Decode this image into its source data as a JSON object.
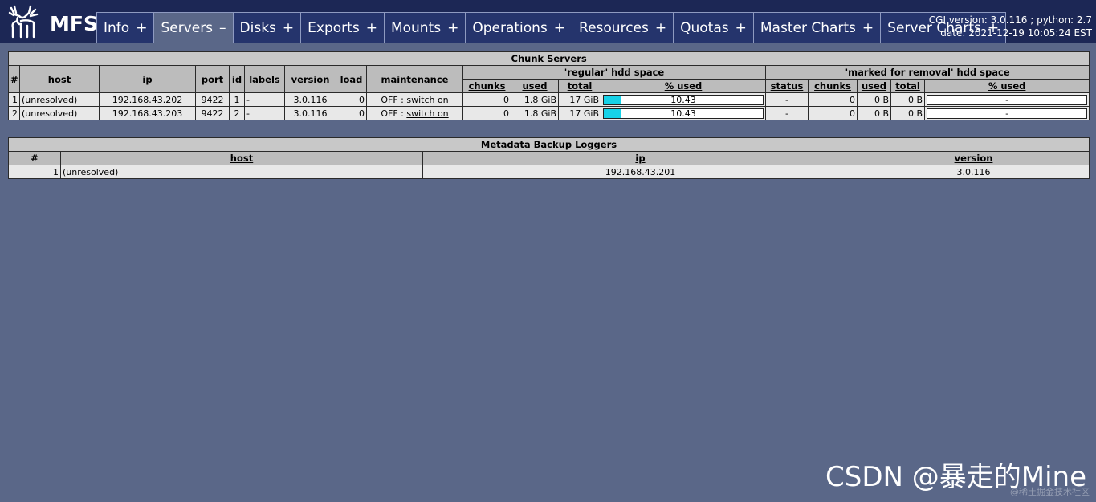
{
  "header": {
    "logo_text": "MFS",
    "cgi_version_line": "CGI version: 3.0.116 ; python: 2.7",
    "date_line": "date: 2021-12-19 10:05:24 EST",
    "tabs": [
      {
        "label": "Info",
        "sign": "+"
      },
      {
        "label": "Servers",
        "sign": "–",
        "active": true
      },
      {
        "label": "Disks",
        "sign": "+"
      },
      {
        "label": "Exports",
        "sign": "+"
      },
      {
        "label": "Mounts",
        "sign": "+"
      },
      {
        "label": "Operations",
        "sign": "+"
      },
      {
        "label": "Resources",
        "sign": "+"
      },
      {
        "label": "Quotas",
        "sign": "+"
      },
      {
        "label": "Master Charts",
        "sign": "+"
      },
      {
        "label": "Server Charts",
        "sign": "+"
      }
    ]
  },
  "chunk_servers": {
    "title": "Chunk Servers",
    "group_regular": "'regular' hdd space",
    "group_removal": "'marked for removal' hdd space",
    "columns": {
      "num": "#",
      "host": "host",
      "ip": "ip",
      "port": "port",
      "id": "id",
      "labels": "labels",
      "version": "version",
      "load": "load",
      "maintenance": "maintenance",
      "chunks": "chunks",
      "used": "used",
      "total": "total",
      "pct_used": "% used",
      "status": "status"
    },
    "rows": [
      {
        "num": "1",
        "host": "(unresolved)",
        "ip": "192.168.43.202",
        "port": "9422",
        "id": "1",
        "labels": "-",
        "version": "3.0.116",
        "load": "0",
        "maint_state": "OFF : ",
        "maint_link": "switch on",
        "reg_chunks": "0",
        "reg_used": "1.8 GiB",
        "reg_total": "17 GiB",
        "reg_pct": "10.43",
        "reg_pct_value": 10.43,
        "rm_status": "-",
        "rm_chunks": "0",
        "rm_used": "0 B",
        "rm_total": "0 B",
        "rm_pct": "-"
      },
      {
        "num": "2",
        "host": "(unresolved)",
        "ip": "192.168.43.203",
        "port": "9422",
        "id": "2",
        "labels": "-",
        "version": "3.0.116",
        "load": "0",
        "maint_state": "OFF : ",
        "maint_link": "switch on",
        "reg_chunks": "0",
        "reg_used": "1.8 GiB",
        "reg_total": "17 GiB",
        "reg_pct": "10.43",
        "reg_pct_value": 10.43,
        "rm_status": "-",
        "rm_chunks": "0",
        "rm_used": "0 B",
        "rm_total": "0 B",
        "rm_pct": "-"
      }
    ]
  },
  "metaloggers": {
    "title": "Metadata Backup Loggers",
    "columns": {
      "num": "#",
      "host": "host",
      "ip": "ip",
      "version": "version"
    },
    "rows": [
      {
        "num": "1",
        "host": "(unresolved)",
        "ip": "192.168.43.201",
        "version": "3.0.116"
      }
    ]
  },
  "watermark": "CSDN @暴走的Mine",
  "watermark_sub": "@稀土掘金技术社区",
  "colors": {
    "header_bg": "#1c2755",
    "page_bg": "#5a6788",
    "bar_fill": "#16d2e8"
  }
}
